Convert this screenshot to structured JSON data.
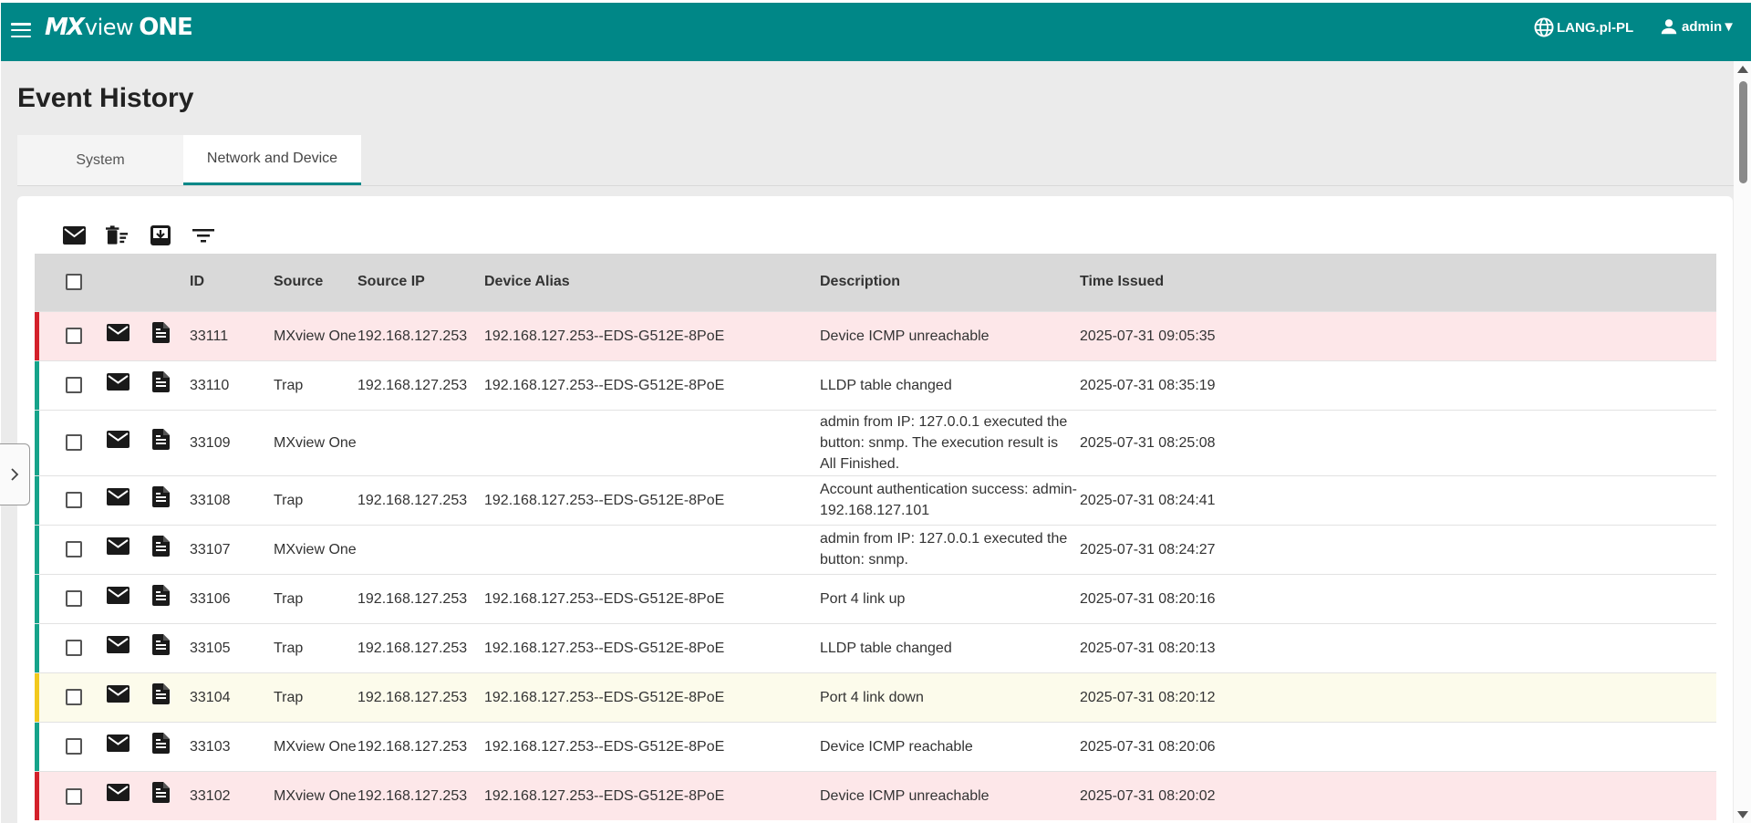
{
  "header": {
    "logo": {
      "mx": "MX",
      "view": "view",
      "one": "ONE"
    },
    "language": "LANG.pl-PL",
    "user": "admin▼"
  },
  "page": {
    "title": "Event History",
    "tabs": [
      {
        "label": "System",
        "active": false
      },
      {
        "label": "Network and Device",
        "active": true
      }
    ]
  },
  "toolbar": {
    "icons": [
      "mail-icon",
      "delete-list-icon",
      "export-icon",
      "filter-icon"
    ]
  },
  "table": {
    "columns": [
      "ID",
      "Source",
      "Source IP",
      "Device Alias",
      "Description",
      "Time Issued"
    ],
    "rows": [
      {
        "severity": "#d3202a",
        "bg": "#fde7e9",
        "id": "33111",
        "source": "MXview One",
        "ip": "192.168.127.253",
        "alias": "192.168.127.253--EDS-G512E-8PoE",
        "description": "Device ICMP unreachable",
        "time": "2025-07-31 09:05:35"
      },
      {
        "severity": "#16a38a",
        "bg": "#ffffff",
        "id": "33110",
        "source": "Trap",
        "ip": "192.168.127.253",
        "alias": "192.168.127.253--EDS-G512E-8PoE",
        "description": "LLDP table changed",
        "time": "2025-07-31 08:35:19"
      },
      {
        "severity": "#16a38a",
        "bg": "#ffffff",
        "id": "33109",
        "source": "MXview One",
        "ip": "",
        "alias": "",
        "description": "admin from IP: 127.0.0.1 executed the button: snmp. The execution result is All Finished.",
        "time": "2025-07-31 08:25:08"
      },
      {
        "severity": "#16a38a",
        "bg": "#ffffff",
        "id": "33108",
        "source": "Trap",
        "ip": "192.168.127.253",
        "alias": "192.168.127.253--EDS-G512E-8PoE",
        "description": "Account authentication success: admin-192.168.127.101",
        "time": "2025-07-31 08:24:41"
      },
      {
        "severity": "#16a38a",
        "bg": "#ffffff",
        "id": "33107",
        "source": "MXview One",
        "ip": "",
        "alias": "",
        "description": "admin from IP: 127.0.0.1 executed the button: snmp.",
        "time": "2025-07-31 08:24:27"
      },
      {
        "severity": "#16a38a",
        "bg": "#ffffff",
        "id": "33106",
        "source": "Trap",
        "ip": "192.168.127.253",
        "alias": "192.168.127.253--EDS-G512E-8PoE",
        "description": "Port 4 link up",
        "time": "2025-07-31 08:20:16"
      },
      {
        "severity": "#16a38a",
        "bg": "#ffffff",
        "id": "33105",
        "source": "Trap",
        "ip": "192.168.127.253",
        "alias": "192.168.127.253--EDS-G512E-8PoE",
        "description": "LLDP table changed",
        "time": "2025-07-31 08:20:13"
      },
      {
        "severity": "#f2c91d",
        "bg": "#fcfbeb",
        "id": "33104",
        "source": "Trap",
        "ip": "192.168.127.253",
        "alias": "192.168.127.253--EDS-G512E-8PoE",
        "description": "Port 4 link down",
        "time": "2025-07-31 08:20:12"
      },
      {
        "severity": "#16a38a",
        "bg": "#ffffff",
        "id": "33103",
        "source": "MXview One",
        "ip": "192.168.127.253",
        "alias": "192.168.127.253--EDS-G512E-8PoE",
        "description": "Device ICMP reachable",
        "time": "2025-07-31 08:20:06"
      },
      {
        "severity": "#d3202a",
        "bg": "#fde7e9",
        "id": "33102",
        "source": "MXview One",
        "ip": "192.168.127.253",
        "alias": "192.168.127.253--EDS-G512E-8PoE",
        "description": "Device ICMP unreachable",
        "time": "2025-07-31 08:20:02"
      }
    ]
  },
  "colors": {
    "brand": "#008787",
    "critical": "#d3202a",
    "warning": "#f2c91d",
    "info": "#16a38a"
  }
}
